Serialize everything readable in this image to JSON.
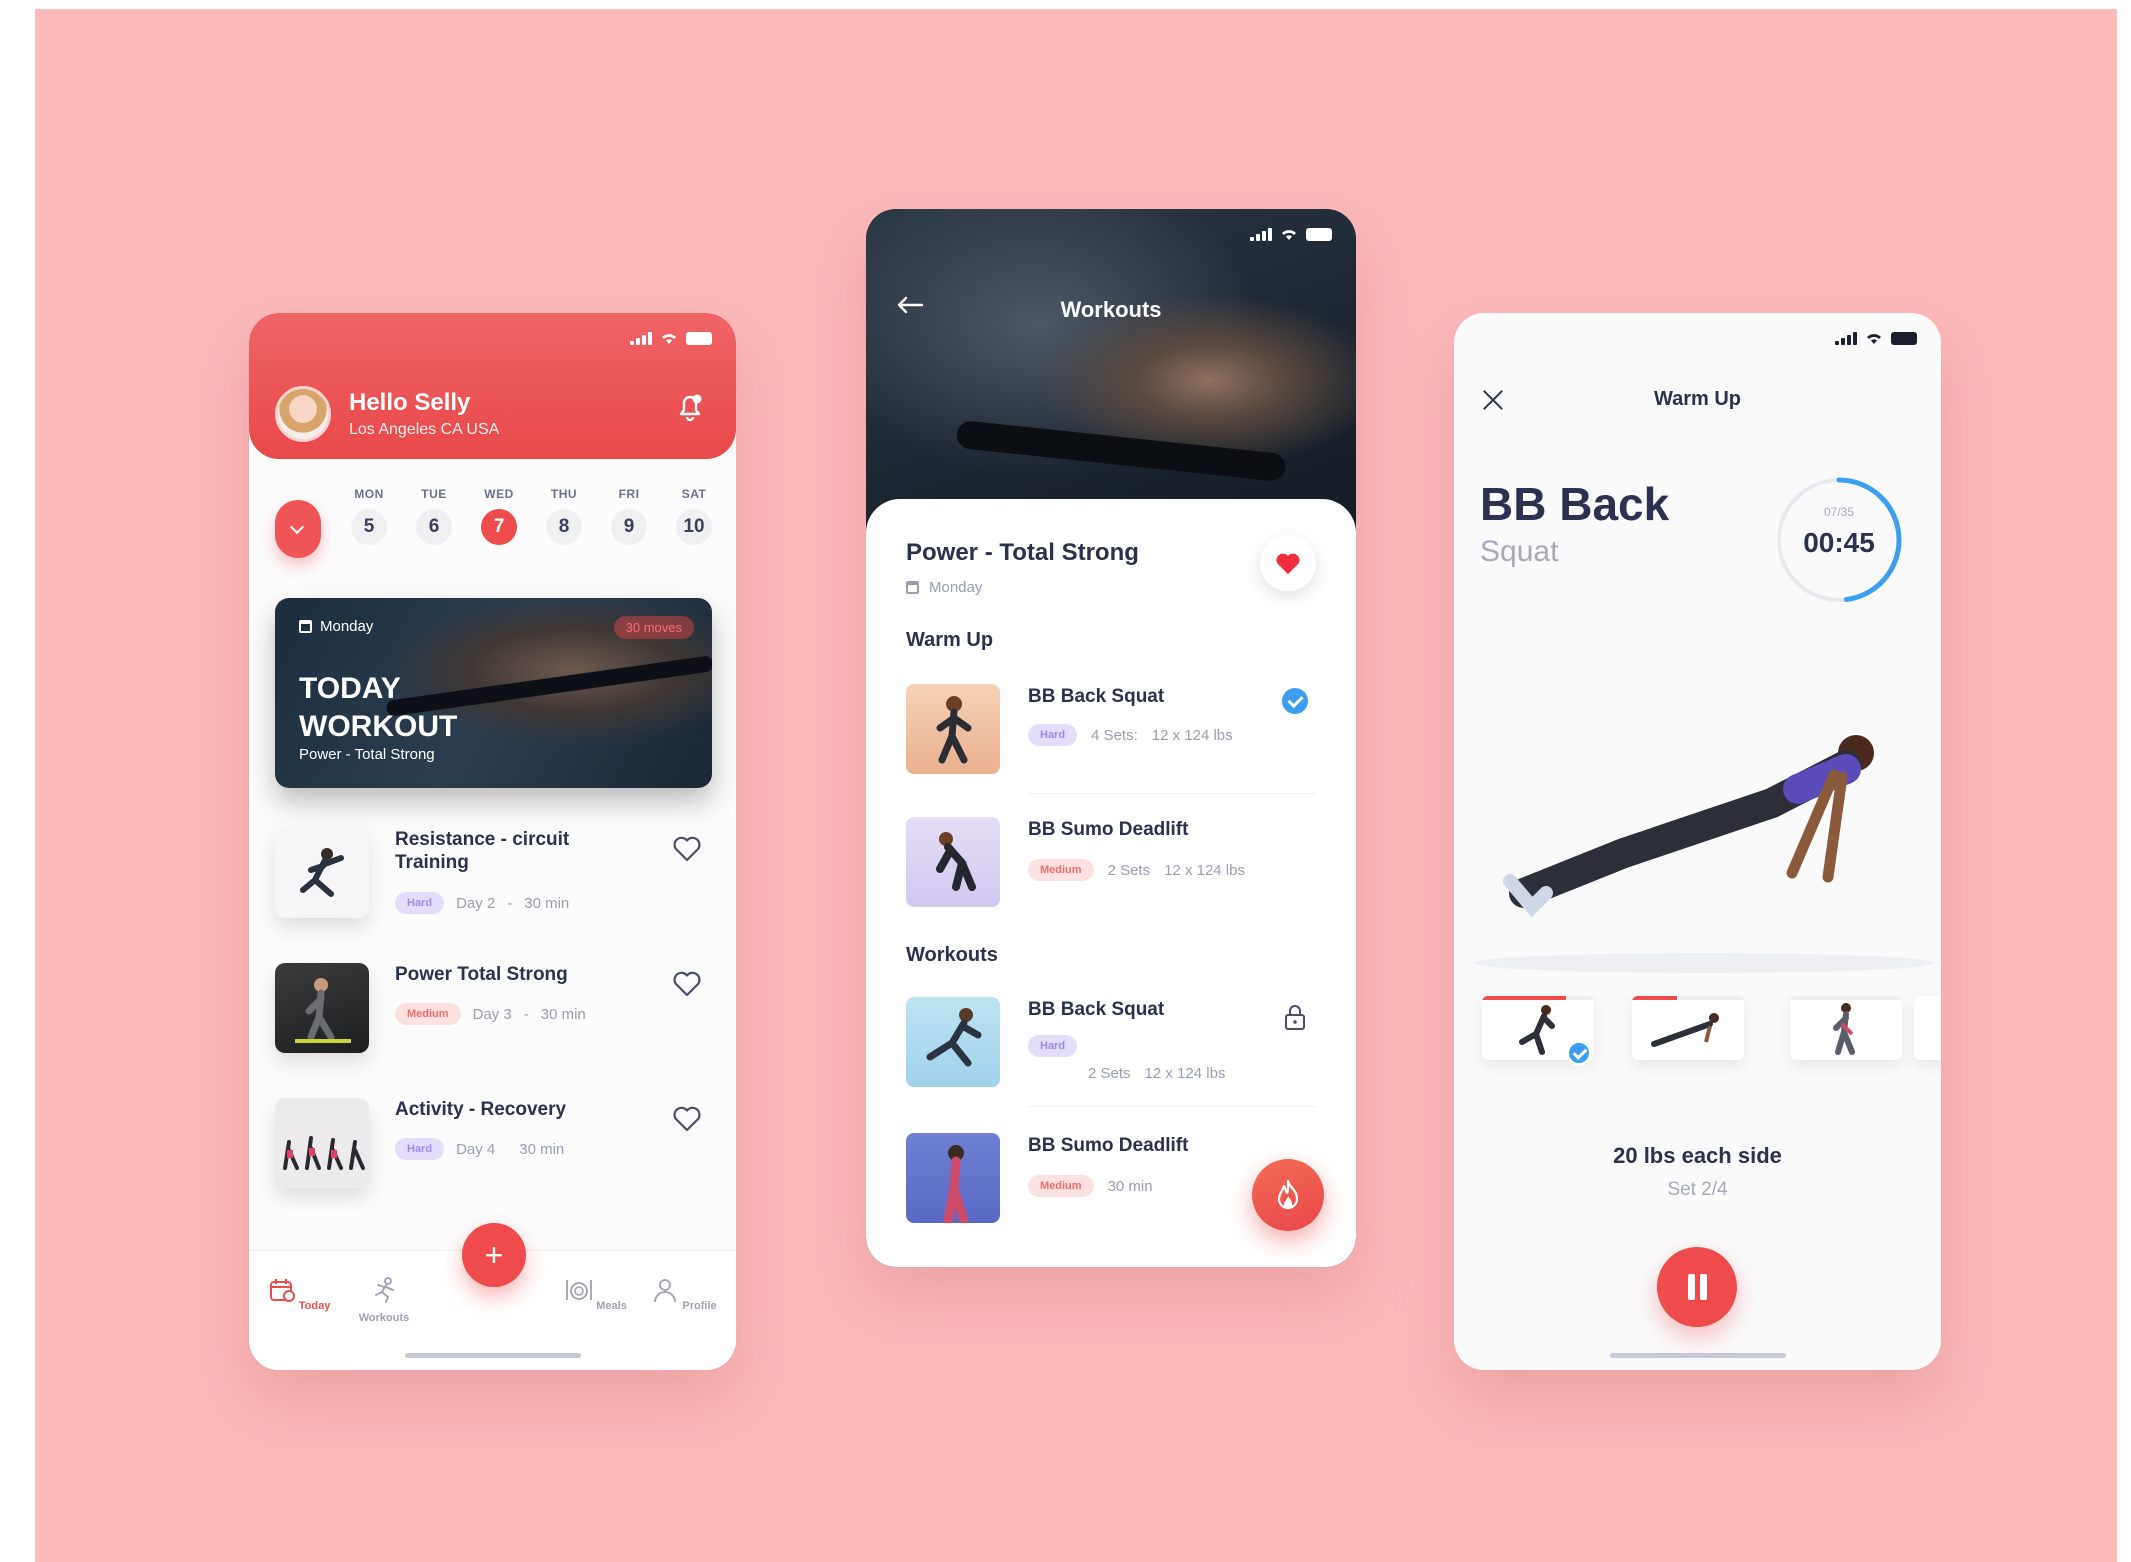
{
  "colors": {
    "background": "#fbb9ba",
    "accent": "#ef4a4c",
    "check": "#3c9ef0",
    "hard": "#9d8ae6",
    "medium": "#ef6c6e"
  },
  "today": {
    "greeting": "Hello Selly",
    "location": "Los Angeles CA USA",
    "week": [
      {
        "day": "MON",
        "date": "5"
      },
      {
        "day": "TUE",
        "date": "6"
      },
      {
        "day": "WED",
        "date": "7",
        "active": true
      },
      {
        "day": "THU",
        "date": "8"
      },
      {
        "day": "FRI",
        "date": "9"
      },
      {
        "day": "SAT",
        "date": "10"
      }
    ],
    "card": {
      "day": "Monday",
      "badge": "30 moves",
      "title": "TODAY WORKOUT",
      "subtitle": "Power - Total Strong"
    },
    "workouts": [
      {
        "title": "Resistance - circuit Training",
        "tag": "Hard",
        "day": "Day 2",
        "sep": "-",
        "duration": "30 min"
      },
      {
        "title": "Power Total Strong",
        "tag": "Medium",
        "day": "Day 3",
        "sep": "-",
        "duration": "30 min"
      },
      {
        "title": "Activity - Recovery",
        "tag": "Hard",
        "day": "Day 4",
        "sep": "",
        "duration": "30 min"
      }
    ],
    "fab_label": "+",
    "nav": [
      {
        "label": "Today",
        "icon": "calendar-icon"
      },
      {
        "label": "Workouts",
        "icon": "runner-icon"
      },
      {
        "label": "Meals",
        "icon": "meals-icon"
      },
      {
        "label": "Profile",
        "icon": "profile-icon"
      }
    ]
  },
  "workouts_screen": {
    "header_title": "Workouts",
    "back_icon": "arrow-left-icon",
    "program_title": "Power - Total Strong",
    "program_day": "Monday",
    "warmup_title": "Warm Up",
    "warmup": [
      {
        "title": "BB Back Squat",
        "tag": "Hard",
        "sets": "4 Sets:",
        "reps": "12 x 124 lbs",
        "done": true
      },
      {
        "title": "BB Sumo Deadlift",
        "tag": "Medium",
        "sets": "2 Sets",
        "reps": "12 x 124 lbs",
        "done": false
      }
    ],
    "workouts_title": "Workouts",
    "workouts": [
      {
        "title": "BB Back Squat",
        "tag": "Hard",
        "sets": "2 Sets",
        "reps": "12 x 124 lbs",
        "locked": true
      },
      {
        "title": "BB Sumo Deadlift",
        "tag": "Medium",
        "duration": "30 min",
        "locked": true
      }
    ]
  },
  "warmup_screen": {
    "header_title": "Warm Up",
    "exercise_line1": "BB Back",
    "exercise_line2": "Squat",
    "timer_count": "07/35",
    "timer_time": "00:45",
    "timer_progress": 0.48,
    "steps": [
      {
        "progress": 0.75,
        "done": true
      },
      {
        "progress": 0.4,
        "done": false
      },
      {
        "progress": 0,
        "done": false
      }
    ],
    "weight": "20 lbs each side",
    "set": "Set 2/4"
  }
}
